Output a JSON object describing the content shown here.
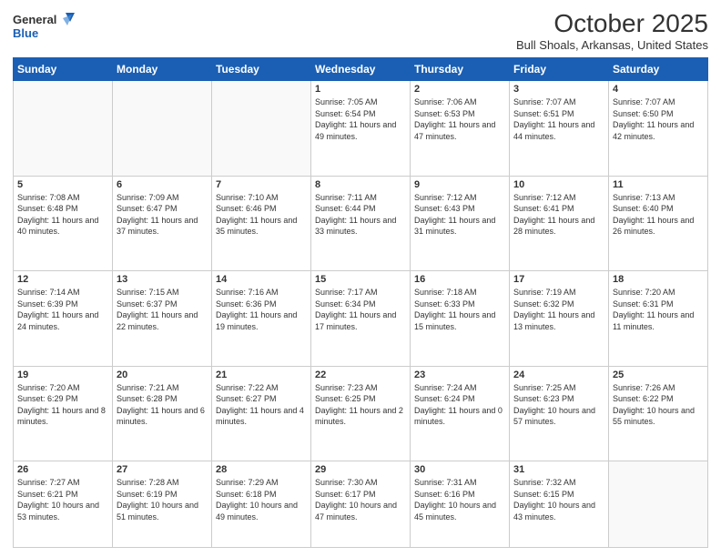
{
  "logo": {
    "general": "General",
    "blue": "Blue"
  },
  "header": {
    "month": "October 2025",
    "location": "Bull Shoals, Arkansas, United States"
  },
  "weekdays": [
    "Sunday",
    "Monday",
    "Tuesday",
    "Wednesday",
    "Thursday",
    "Friday",
    "Saturday"
  ],
  "weeks": [
    [
      {
        "day": "",
        "info": ""
      },
      {
        "day": "",
        "info": ""
      },
      {
        "day": "",
        "info": ""
      },
      {
        "day": "1",
        "info": "Sunrise: 7:05 AM\nSunset: 6:54 PM\nDaylight: 11 hours and 49 minutes."
      },
      {
        "day": "2",
        "info": "Sunrise: 7:06 AM\nSunset: 6:53 PM\nDaylight: 11 hours and 47 minutes."
      },
      {
        "day": "3",
        "info": "Sunrise: 7:07 AM\nSunset: 6:51 PM\nDaylight: 11 hours and 44 minutes."
      },
      {
        "day": "4",
        "info": "Sunrise: 7:07 AM\nSunset: 6:50 PM\nDaylight: 11 hours and 42 minutes."
      }
    ],
    [
      {
        "day": "5",
        "info": "Sunrise: 7:08 AM\nSunset: 6:48 PM\nDaylight: 11 hours and 40 minutes."
      },
      {
        "day": "6",
        "info": "Sunrise: 7:09 AM\nSunset: 6:47 PM\nDaylight: 11 hours and 37 minutes."
      },
      {
        "day": "7",
        "info": "Sunrise: 7:10 AM\nSunset: 6:46 PM\nDaylight: 11 hours and 35 minutes."
      },
      {
        "day": "8",
        "info": "Sunrise: 7:11 AM\nSunset: 6:44 PM\nDaylight: 11 hours and 33 minutes."
      },
      {
        "day": "9",
        "info": "Sunrise: 7:12 AM\nSunset: 6:43 PM\nDaylight: 11 hours and 31 minutes."
      },
      {
        "day": "10",
        "info": "Sunrise: 7:12 AM\nSunset: 6:41 PM\nDaylight: 11 hours and 28 minutes."
      },
      {
        "day": "11",
        "info": "Sunrise: 7:13 AM\nSunset: 6:40 PM\nDaylight: 11 hours and 26 minutes."
      }
    ],
    [
      {
        "day": "12",
        "info": "Sunrise: 7:14 AM\nSunset: 6:39 PM\nDaylight: 11 hours and 24 minutes."
      },
      {
        "day": "13",
        "info": "Sunrise: 7:15 AM\nSunset: 6:37 PM\nDaylight: 11 hours and 22 minutes."
      },
      {
        "day": "14",
        "info": "Sunrise: 7:16 AM\nSunset: 6:36 PM\nDaylight: 11 hours and 19 minutes."
      },
      {
        "day": "15",
        "info": "Sunrise: 7:17 AM\nSunset: 6:34 PM\nDaylight: 11 hours and 17 minutes."
      },
      {
        "day": "16",
        "info": "Sunrise: 7:18 AM\nSunset: 6:33 PM\nDaylight: 11 hours and 15 minutes."
      },
      {
        "day": "17",
        "info": "Sunrise: 7:19 AM\nSunset: 6:32 PM\nDaylight: 11 hours and 13 minutes."
      },
      {
        "day": "18",
        "info": "Sunrise: 7:20 AM\nSunset: 6:31 PM\nDaylight: 11 hours and 11 minutes."
      }
    ],
    [
      {
        "day": "19",
        "info": "Sunrise: 7:20 AM\nSunset: 6:29 PM\nDaylight: 11 hours and 8 minutes."
      },
      {
        "day": "20",
        "info": "Sunrise: 7:21 AM\nSunset: 6:28 PM\nDaylight: 11 hours and 6 minutes."
      },
      {
        "day": "21",
        "info": "Sunrise: 7:22 AM\nSunset: 6:27 PM\nDaylight: 11 hours and 4 minutes."
      },
      {
        "day": "22",
        "info": "Sunrise: 7:23 AM\nSunset: 6:25 PM\nDaylight: 11 hours and 2 minutes."
      },
      {
        "day": "23",
        "info": "Sunrise: 7:24 AM\nSunset: 6:24 PM\nDaylight: 11 hours and 0 minutes."
      },
      {
        "day": "24",
        "info": "Sunrise: 7:25 AM\nSunset: 6:23 PM\nDaylight: 10 hours and 57 minutes."
      },
      {
        "day": "25",
        "info": "Sunrise: 7:26 AM\nSunset: 6:22 PM\nDaylight: 10 hours and 55 minutes."
      }
    ],
    [
      {
        "day": "26",
        "info": "Sunrise: 7:27 AM\nSunset: 6:21 PM\nDaylight: 10 hours and 53 minutes."
      },
      {
        "day": "27",
        "info": "Sunrise: 7:28 AM\nSunset: 6:19 PM\nDaylight: 10 hours and 51 minutes."
      },
      {
        "day": "28",
        "info": "Sunrise: 7:29 AM\nSunset: 6:18 PM\nDaylight: 10 hours and 49 minutes."
      },
      {
        "day": "29",
        "info": "Sunrise: 7:30 AM\nSunset: 6:17 PM\nDaylight: 10 hours and 47 minutes."
      },
      {
        "day": "30",
        "info": "Sunrise: 7:31 AM\nSunset: 6:16 PM\nDaylight: 10 hours and 45 minutes."
      },
      {
        "day": "31",
        "info": "Sunrise: 7:32 AM\nSunset: 6:15 PM\nDaylight: 10 hours and 43 minutes."
      },
      {
        "day": "",
        "info": ""
      }
    ]
  ]
}
